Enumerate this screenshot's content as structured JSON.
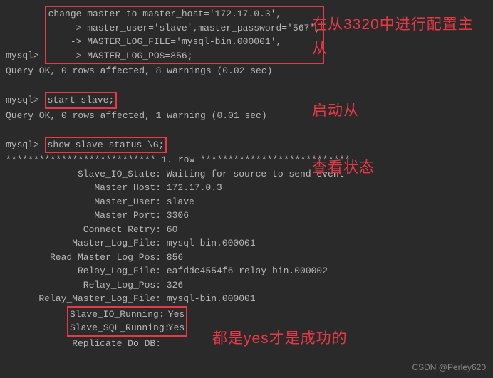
{
  "prompt": "mysql>",
  "cont": "    ->",
  "cmd1": {
    "l1": "change master to master_host='172.17.0.3',",
    "l2": "master_user='slave',master_password='567',",
    "l3": "MASTER_LOG_FILE='mysql-bin.000001',",
    "l4": "MASTER_LOG_POS=856;"
  },
  "result1": "Query OK, 0 rows affected, 8 warnings (0.02 sec)",
  "cmd2": "start slave;",
  "result2": "Query OK, 0 rows affected, 1 warning (0.01 sec)",
  "cmd3": "show slave status \\G;",
  "row_separator": "*************************** 1. row ***************************",
  "status": [
    {
      "k": "Slave_IO_State:",
      "v": " Waiting for source to send event"
    },
    {
      "k": "Master_Host:",
      "v": " 172.17.0.3"
    },
    {
      "k": "Master_User:",
      "v": " slave"
    },
    {
      "k": "Master_Port:",
      "v": " 3306"
    },
    {
      "k": "Connect_Retry:",
      "v": " 60"
    },
    {
      "k": "Master_Log_File:",
      "v": " mysql-bin.000001"
    },
    {
      "k": "Read_Master_Log_Pos:",
      "v": " 856"
    },
    {
      "k": "Relay_Log_File:",
      "v": " eafddc4554f6-relay-bin.000002"
    },
    {
      "k": "Relay_Log_Pos:",
      "v": " 326"
    },
    {
      "k": "Relay_Master_Log_File:",
      "v": " mysql-bin.000001"
    }
  ],
  "running": [
    {
      "k": "Slave_IO_Running:",
      "v": " Yes"
    },
    {
      "k": "Slave_SQL_Running:",
      "v": " Yes"
    }
  ],
  "replicate": {
    "k": "Replicate_Do_DB:",
    "v": " "
  },
  "annotations": {
    "a1": "在从3320中进行配置主从",
    "a2": "启动从",
    "a3": "查看状态",
    "a4": "都是yes才是成功的"
  },
  "watermark": "CSDN @Perley620"
}
